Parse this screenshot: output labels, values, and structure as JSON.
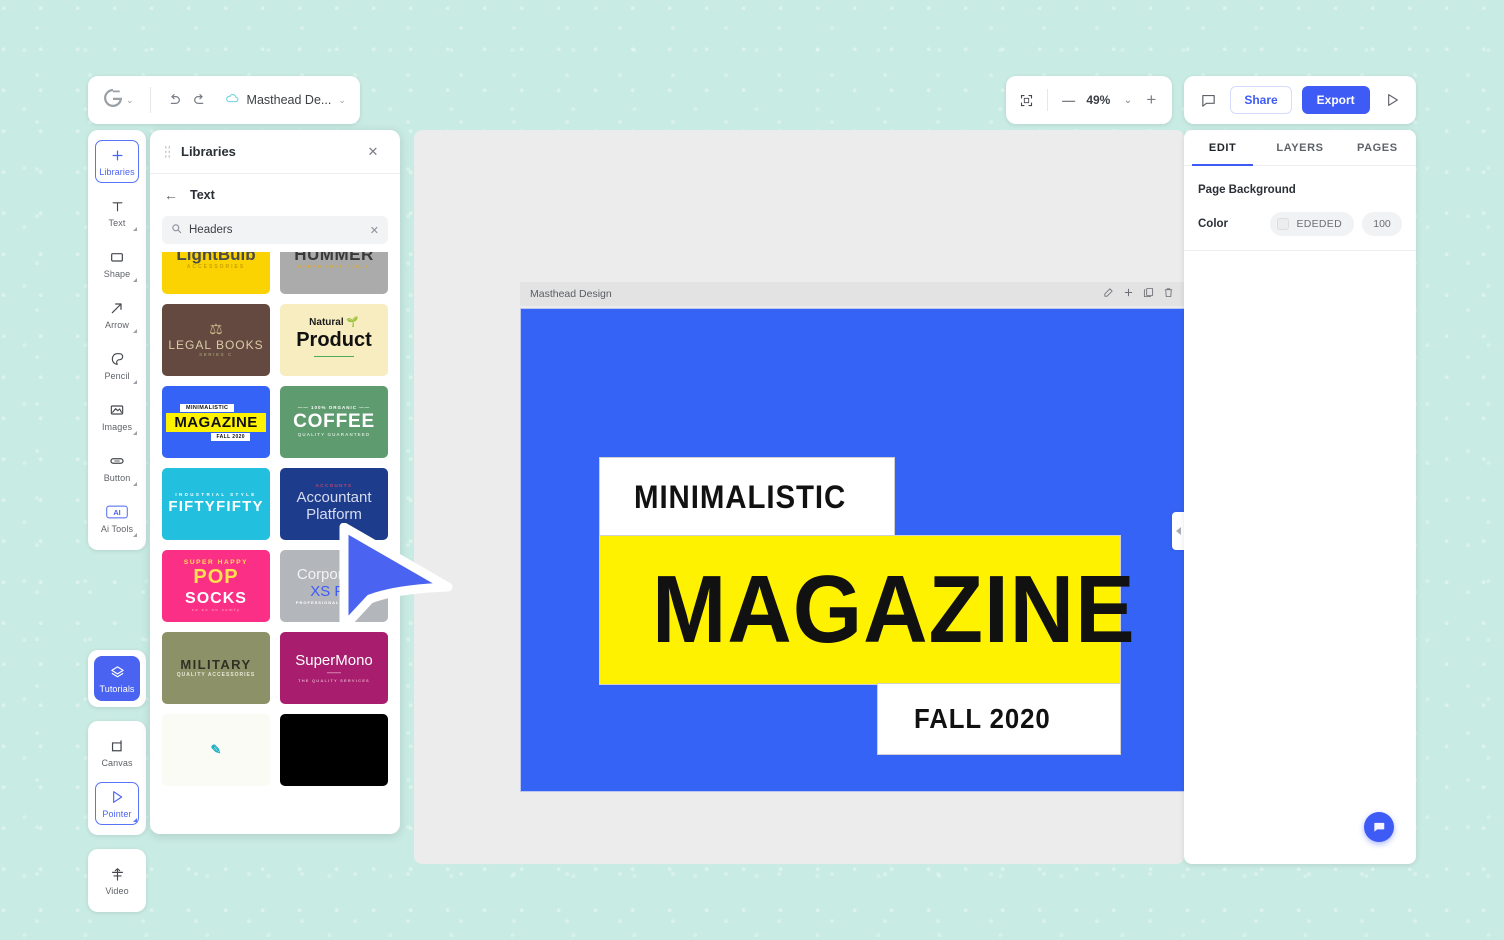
{
  "topbar": {
    "logo_icon": "google-g-icon",
    "logo_caret": "⌄",
    "undo_icon": "↶",
    "redo_icon": "↷",
    "cloud_icon": "☁",
    "doc_title": "Masthead De...",
    "doc_caret": "⌄",
    "fit_icon": "⬚",
    "zoom_out": "—",
    "zoom_value": "49%",
    "zoom_caret": "⌄",
    "zoom_in": "+",
    "comment_icon": "▭",
    "share_label": "Share",
    "export_label": "Export",
    "present_icon": "▷"
  },
  "rail": {
    "groups": [
      {
        "items": [
          {
            "label": "Libraries",
            "icon": "plus-icon",
            "glyph": "+",
            "state": "selected",
            "corner": false
          },
          {
            "label": "Text",
            "icon": "text-icon",
            "glyph": "T",
            "state": "normal",
            "corner": true
          },
          {
            "label": "Shape",
            "icon": "shape-icon",
            "glyph": "▭",
            "state": "normal",
            "corner": true
          },
          {
            "label": "Arrow",
            "icon": "arrow-icon",
            "glyph": "↗",
            "state": "normal",
            "corner": true
          },
          {
            "label": "Pencil",
            "icon": "pencil-icon",
            "glyph": "◖",
            "state": "normal",
            "corner": true
          },
          {
            "label": "Images",
            "icon": "image-icon",
            "glyph": "⛰",
            "state": "normal",
            "corner": true
          },
          {
            "label": "Button",
            "icon": "button-icon",
            "glyph": "▭",
            "state": "normal",
            "corner": true
          },
          {
            "label": "Ai Tools",
            "icon": "ai-icon",
            "glyph": "AI",
            "state": "normal",
            "corner": true
          }
        ]
      },
      {
        "items": [
          {
            "label": "Tutorials",
            "icon": "layers-diamond-icon",
            "glyph": "◇",
            "state": "filled",
            "corner": false
          }
        ]
      },
      {
        "items": [
          {
            "label": "Canvas",
            "icon": "canvas-icon",
            "glyph": "▭",
            "state": "normal",
            "corner": false
          },
          {
            "label": "Pointer",
            "icon": "pointer-icon",
            "glyph": "▷",
            "state": "selected",
            "corner": true
          }
        ]
      },
      {
        "items": [
          {
            "label": "Video",
            "icon": "video-timeline-icon",
            "glyph": "╁",
            "state": "normal",
            "corner": false
          }
        ]
      }
    ]
  },
  "library_panel": {
    "title": "Libraries",
    "drag_handle_icon": "drag-dots-icon",
    "close_icon": "✕",
    "back_icon": "←",
    "category": "Text",
    "search": {
      "icon": "search-icon",
      "value": "Headers",
      "placeholder": "Search",
      "clear_icon": "✕"
    },
    "cards": [
      {
        "name": "lightbulb-accessories",
        "bg": "#fbd302",
        "lines": [
          {
            "text": "LightBulb",
            "size": 17,
            "weight": 800,
            "color": "#4a4a4a",
            "spacing": 0
          },
          {
            "text": "ACCESSORIES",
            "size": 5,
            "weight": 700,
            "color": "#c9a100",
            "spacing": 2
          }
        ]
      },
      {
        "name": "hummer",
        "bg": "#ababab",
        "lines": [
          {
            "text": "HUMMER",
            "size": 17,
            "weight": 800,
            "color": "#3a3a3a",
            "spacing": 0.5
          },
          {
            "text": "URBAN SOFT TOOLS",
            "size": 4.5,
            "weight": 700,
            "color": "#d8a93c",
            "spacing": 1.6
          }
        ]
      },
      {
        "name": "legal-books",
        "bg": "#63493f",
        "lines": [
          {
            "text": "⚖",
            "size": 15,
            "weight": 400,
            "color": "#cbb98a",
            "spacing": 0
          },
          {
            "text": "LEGAL BOOKS",
            "size": 12,
            "weight": 500,
            "color": "#d9cca6",
            "spacing": 1
          },
          {
            "text": "SERIES C",
            "size": 4.5,
            "weight": 600,
            "color": "#9b8f70",
            "spacing": 1.6
          }
        ]
      },
      {
        "name": "natural-product",
        "bg": "#f8edc0",
        "lines": [
          {
            "text": "Natural 🌱",
            "size": 10,
            "weight": 700,
            "color": "#1a1a1a",
            "spacing": 0
          },
          {
            "text": "Product",
            "size": 20,
            "weight": 900,
            "color": "#111111",
            "spacing": 0
          },
          {
            "text": "—————",
            "size": 8,
            "weight": 900,
            "color": "#2f9e44",
            "spacing": 0
          }
        ]
      },
      {
        "name": "minimalistic-magazine-fall-2020",
        "bg": "#3563f5",
        "kind": "masthead",
        "lines": [
          {
            "text": "MINIMALISTIC",
            "size": 5.5,
            "weight": 800,
            "color": "#111111",
            "spacing": 0.4
          },
          {
            "text": "MAGAZINE",
            "size": 15,
            "weight": 900,
            "color": "#111111",
            "spacing": 0.4
          },
          {
            "text": "FALL 2020",
            "size": 5,
            "weight": 800,
            "color": "#111111",
            "spacing": 0.4
          }
        ]
      },
      {
        "name": "organic-coffee",
        "bg": "#5e9b6e",
        "lines": [
          {
            "text": "—— 100% ORGANIC ——",
            "size": 4.5,
            "weight": 700,
            "color": "#ffffff",
            "spacing": 1
          },
          {
            "text": "COFFEE",
            "size": 19,
            "weight": 900,
            "color": "#ffffff",
            "spacing": 0.8
          },
          {
            "text": "QUALITY GUARANTEED",
            "size": 4.5,
            "weight": 700,
            "color": "#cfe3d4",
            "spacing": 1.1
          }
        ]
      },
      {
        "name": "fifty-fifty",
        "bg": "#22c0de",
        "lines": [
          {
            "text": "INDUSTRIAL STYLE",
            "size": 4.5,
            "weight": 700,
            "color": "#ffffff",
            "spacing": 2.4
          },
          {
            "text": "FIFTYFIFTY",
            "size": 15,
            "weight": 700,
            "color": "#ffffff",
            "spacing": 1.2
          }
        ]
      },
      {
        "name": "accountant-platform",
        "bg": "#1e3c8c",
        "lines": [
          {
            "text": "ACCOUNTS",
            "size": 4.5,
            "weight": 700,
            "color": "#c2476b",
            "spacing": 1.4
          },
          {
            "text": "Accountant",
            "size": 15,
            "weight": 400,
            "color": "#d7dcef",
            "spacing": 0
          },
          {
            "text": "Platform",
            "size": 15,
            "weight": 400,
            "color": "#d7dcef",
            "spacing": 0
          }
        ]
      },
      {
        "name": "super-happy-pop-socks",
        "bg": "#fb2f86",
        "lines": [
          {
            "text": "SUPER  HAPPY",
            "size": 6.5,
            "weight": 800,
            "color": "#ffe14d",
            "spacing": 1.6
          },
          {
            "text": "POP",
            "size": 20,
            "weight": 900,
            "color": "#ffe14d",
            "spacing": 1
          },
          {
            "text": "SOCKS",
            "size": 16,
            "weight": 900,
            "color": "#ffffff",
            "spacing": 1
          },
          {
            "text": "so so so comfy",
            "size": 4,
            "weight": 600,
            "color": "#f78fba",
            "spacing": 1.4
          }
        ]
      },
      {
        "name": "corporates-xs-pro",
        "bg": "#b3b6bb",
        "lines": [
          {
            "text": "Corporates",
            "size": 15,
            "weight": 400,
            "color": "#f2f3f5",
            "spacing": 0
          },
          {
            "text": "XS Pro",
            "size": 15,
            "weight": 500,
            "color": "#3f5bf6",
            "spacing": 0
          },
          {
            "text": "PROFESSIONAL SOFTWARE",
            "size": 4,
            "weight": 700,
            "color": "#ffffff",
            "spacing": 1
          }
        ]
      },
      {
        "name": "military-quality-accessories",
        "bg": "#8d9167",
        "lines": [
          {
            "text": "MILITARY",
            "size": 13,
            "weight": 700,
            "color": "#2f3124",
            "spacing": 1.4
          },
          {
            "text": "QUALITY ACCESSORIES",
            "size": 5,
            "weight": 700,
            "color": "#e6e9d6",
            "spacing": 1
          }
        ]
      },
      {
        "name": "supermono",
        "bg": "#a81d6e",
        "lines": [
          {
            "text": "SuperMono",
            "size": 15,
            "weight": 500,
            "color": "#ffffff",
            "spacing": 0
          },
          {
            "text": "——",
            "size": 7,
            "weight": 700,
            "color": "#e7a3c8",
            "spacing": 0
          },
          {
            "text": "THE QUALITY SERVICES",
            "size": 4,
            "weight": 600,
            "color": "#e7a3c8",
            "spacing": 1.2
          }
        ]
      },
      {
        "name": "light-card",
        "bg": "#fbfbf6",
        "lines": [
          {
            "text": "✎",
            "size": 13,
            "weight": 700,
            "color": "#25b0c4",
            "spacing": 0
          }
        ]
      },
      {
        "name": "black-card",
        "bg": "#000000",
        "lines": []
      }
    ]
  },
  "canvas": {
    "artboard_name": "Masthead Design",
    "actions": [
      {
        "name": "edit-artboard-icon",
        "glyph": "✐"
      },
      {
        "name": "add-artboard-icon",
        "glyph": "+"
      },
      {
        "name": "duplicate-artboard-icon",
        "glyph": "⧉"
      },
      {
        "name": "delete-artboard-icon",
        "glyph": "Ὕ1"
      },
      {
        "name": "download-artboard-icon",
        "glyph": "⤓"
      }
    ],
    "artwork": {
      "background_color": "#3563F5",
      "highlight_color": "#FFF200",
      "line1": "MINIMALISTIC",
      "line2": "MAGAZINE",
      "line3": "FALL 2020"
    },
    "collapse_handle_icon": "chevron-left-icon"
  },
  "right_panel": {
    "tabs": [
      {
        "label": "EDIT",
        "active": true
      },
      {
        "label": "LAYERS",
        "active": false
      },
      {
        "label": "PAGES",
        "active": false
      }
    ],
    "section_title": "Page Background",
    "color_label": "Color",
    "color_value": "EDEDED",
    "opacity_value": "100",
    "chat_fab_icon": "chat-bubble-icon"
  }
}
